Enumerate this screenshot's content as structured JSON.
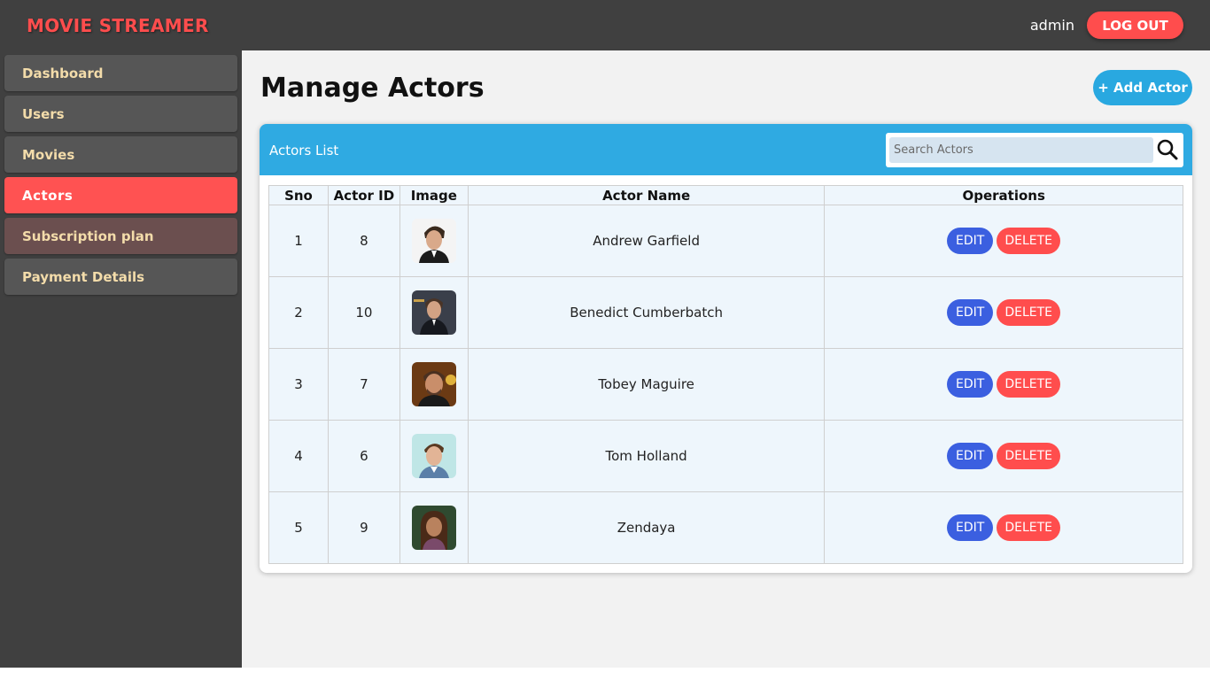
{
  "app": {
    "brand": "MOVIE STREAMER",
    "user": "admin",
    "logout_label": "LOG OUT"
  },
  "sidebar": {
    "items": [
      {
        "label": "Dashboard",
        "active": false
      },
      {
        "label": "Users",
        "active": false
      },
      {
        "label": "Movies",
        "active": false
      },
      {
        "label": "Actors",
        "active": true
      },
      {
        "label": "Subscription plan",
        "active": false
      },
      {
        "label": "Payment Details",
        "active": false
      }
    ]
  },
  "main": {
    "title": "Manage Actors",
    "add_label": "+ Add Actor",
    "card_title": "Actors List",
    "search": {
      "placeholder": "Search Actors",
      "value": ""
    },
    "table": {
      "headers": [
        "Sno",
        "Actor ID",
        "Image",
        "Actor Name",
        "Operations"
      ],
      "edit_label": "EDIT",
      "delete_label": "DELETE",
      "rows": [
        {
          "sno": "1",
          "actor_id": "8",
          "name": "Andrew Garfield"
        },
        {
          "sno": "2",
          "actor_id": "10",
          "name": "Benedict Cumberbatch"
        },
        {
          "sno": "3",
          "actor_id": "7",
          "name": "Tobey Maguire"
        },
        {
          "sno": "4",
          "actor_id": "6",
          "name": "Tom Holland"
        },
        {
          "sno": "5",
          "actor_id": "9",
          "name": "Zendaya"
        }
      ]
    }
  },
  "colors": {
    "topbar": "#404040",
    "brand": "#ff4d4d",
    "active_item": "#ff5252",
    "header_blue": "#2faae2",
    "edit": "#3b5fe0",
    "delete": "#ff4d4d"
  }
}
